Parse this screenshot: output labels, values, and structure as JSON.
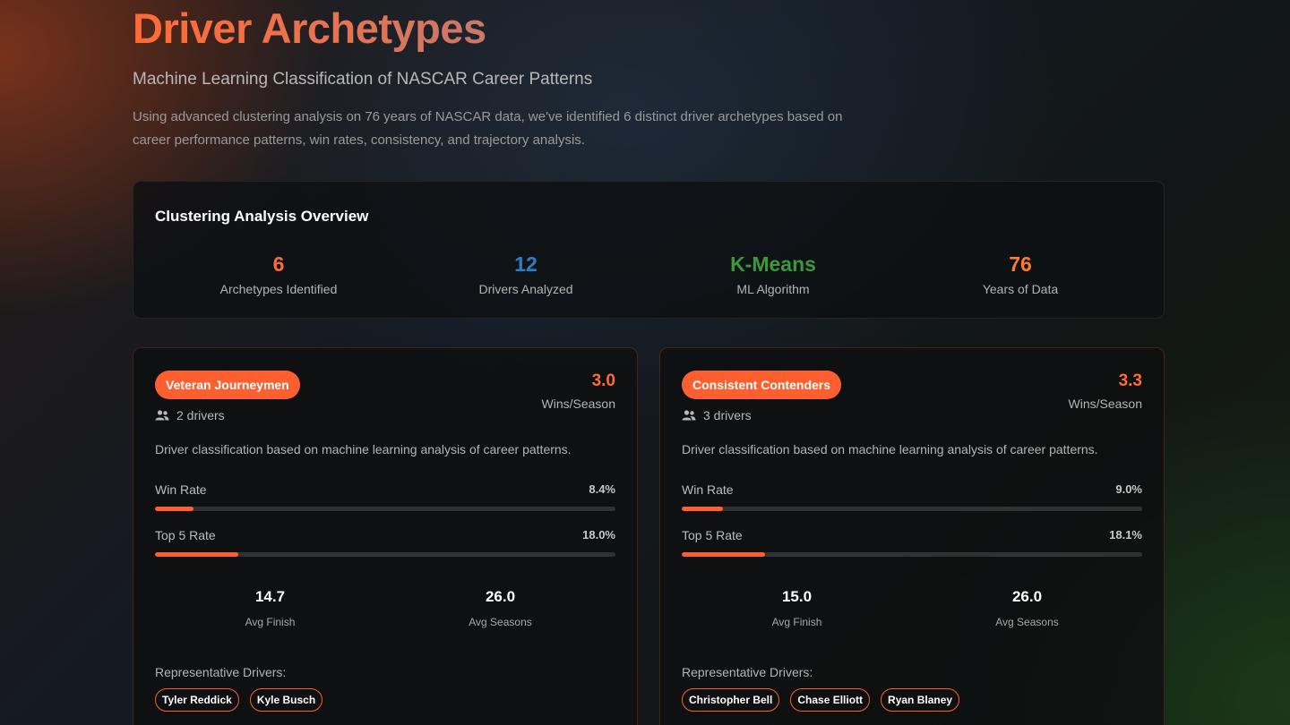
{
  "header": {
    "title": "Driver Archetypes",
    "subtitle": "Machine Learning Classification of NASCAR Career Patterns",
    "description": "Using advanced clustering analysis on 76 years of NASCAR data, we've identified 6 distinct driver archetypes based on career performance patterns, win rates, consistency, and trajectory analysis."
  },
  "overview": {
    "title": "Clustering Analysis Overview",
    "stats": [
      {
        "value": "6",
        "label": "Archetypes Identified",
        "color": "#ff6a35"
      },
      {
        "value": "12",
        "label": "Drivers Analyzed",
        "color": "#2f7fc4"
      },
      {
        "value": "K-Means",
        "label": "ML Algorithm",
        "color": "#3a9a3a"
      },
      {
        "value": "76",
        "label": "Years of Data",
        "color": "#ff7a2a"
      }
    ]
  },
  "cards": [
    {
      "name": "Veteran Journeymen",
      "drivers_count": "2 drivers",
      "wins_value": "3.0",
      "wins_label": "Wins/Season",
      "description": "Driver classification based on machine learning analysis of career patterns.",
      "win_rate_label": "Win Rate",
      "win_rate": "8.4%",
      "win_rate_pct": 8.4,
      "top5_label": "Top 5 Rate",
      "top5_rate": "18.0%",
      "top5_pct": 18.0,
      "avg_finish": "14.7",
      "avg_finish_label": "Avg Finish",
      "avg_seasons": "26.0",
      "avg_seasons_label": "Avg Seasons",
      "rep_title": "Representative Drivers:",
      "drivers": [
        "Tyler Reddick",
        "Kyle Busch"
      ]
    },
    {
      "name": "Consistent Contenders",
      "drivers_count": "3 drivers",
      "wins_value": "3.3",
      "wins_label": "Wins/Season",
      "description": "Driver classification based on machine learning analysis of career patterns.",
      "win_rate_label": "Win Rate",
      "win_rate": "9.0%",
      "win_rate_pct": 9.0,
      "top5_label": "Top 5 Rate",
      "top5_rate": "18.1%",
      "top5_pct": 18.1,
      "avg_finish": "15.0",
      "avg_finish_label": "Avg Finish",
      "avg_seasons": "26.0",
      "avg_seasons_label": "Avg Seasons",
      "rep_title": "Representative Drivers:",
      "drivers": [
        "Christopher Bell",
        "Chase Elliott",
        "Ryan Blaney"
      ]
    }
  ],
  "colors": {
    "accent": "#ff5f2e"
  },
  "icons": {
    "drivers": "people-icon"
  }
}
